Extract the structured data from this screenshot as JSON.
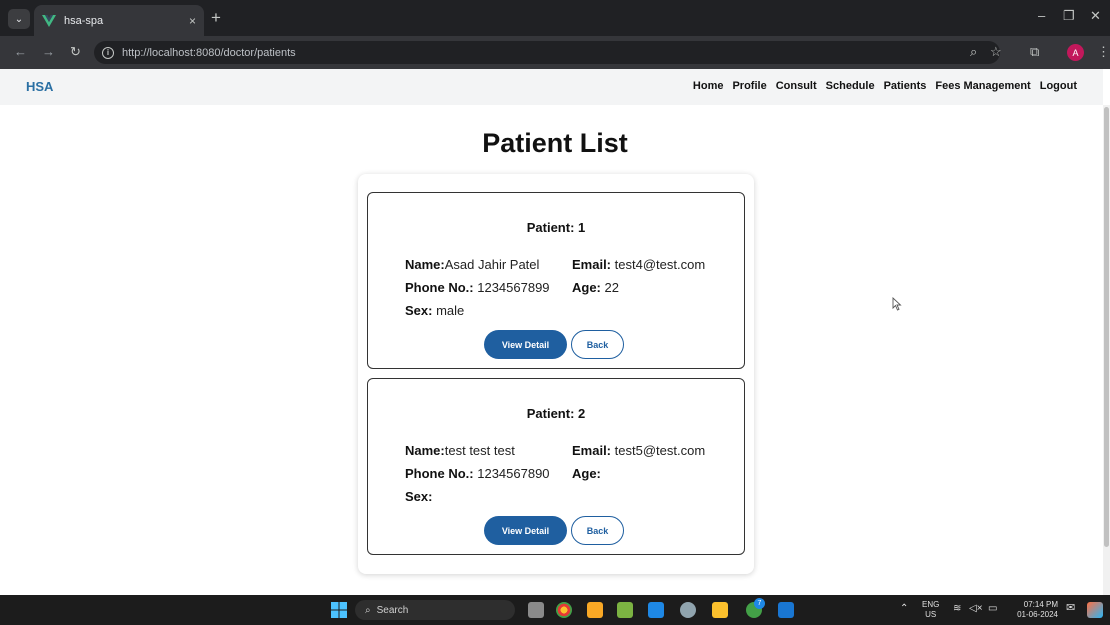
{
  "browser": {
    "tab_menu_glyph": "⌄",
    "tab_title": "hsa-spa",
    "tab_close": "×",
    "new_tab": "+",
    "url": "http://localhost:8080/doctor/patients",
    "profile_initial": "A",
    "minimize": "–",
    "restore": "❐",
    "close": "✕"
  },
  "app": {
    "brand": "HSA",
    "nav": [
      "Home",
      "Profile",
      "Consult",
      "Schedule",
      "Patients",
      "Fees Management",
      "Logout"
    ]
  },
  "page": {
    "title": "Patient List",
    "patients": [
      {
        "title": "Patient: 1",
        "name_label": "Name:",
        "name": "Asad Jahir Patel",
        "email_label": "Email:",
        "email": "test4@test.com",
        "phone_label": "Phone No.:",
        "phone": "1234567899",
        "age_label": "Age:",
        "age": "22",
        "sex_label": "Sex:",
        "sex": "male",
        "detail_button": "View Detail",
        "back_button": "Back"
      },
      {
        "title": "Patient: 2",
        "name_label": "Name:",
        "name": "test test test",
        "email_label": "Email:",
        "email": "test5@test.com",
        "phone_label": "Phone No.:",
        "phone": "1234567890",
        "age_label": "Age:",
        "age": "",
        "sex_label": "Sex:",
        "sex": "",
        "detail_button": "View Detail",
        "back_button": "Back"
      }
    ]
  },
  "taskbar": {
    "search_label": "Search",
    "lang_top": "ENG",
    "lang_bottom": "US",
    "time": "07:14 PM",
    "date": "01-06-2024",
    "badge_count": "7"
  },
  "colors": {
    "brand": "#2a6fa3",
    "primary_button": "#1f5fa0"
  }
}
